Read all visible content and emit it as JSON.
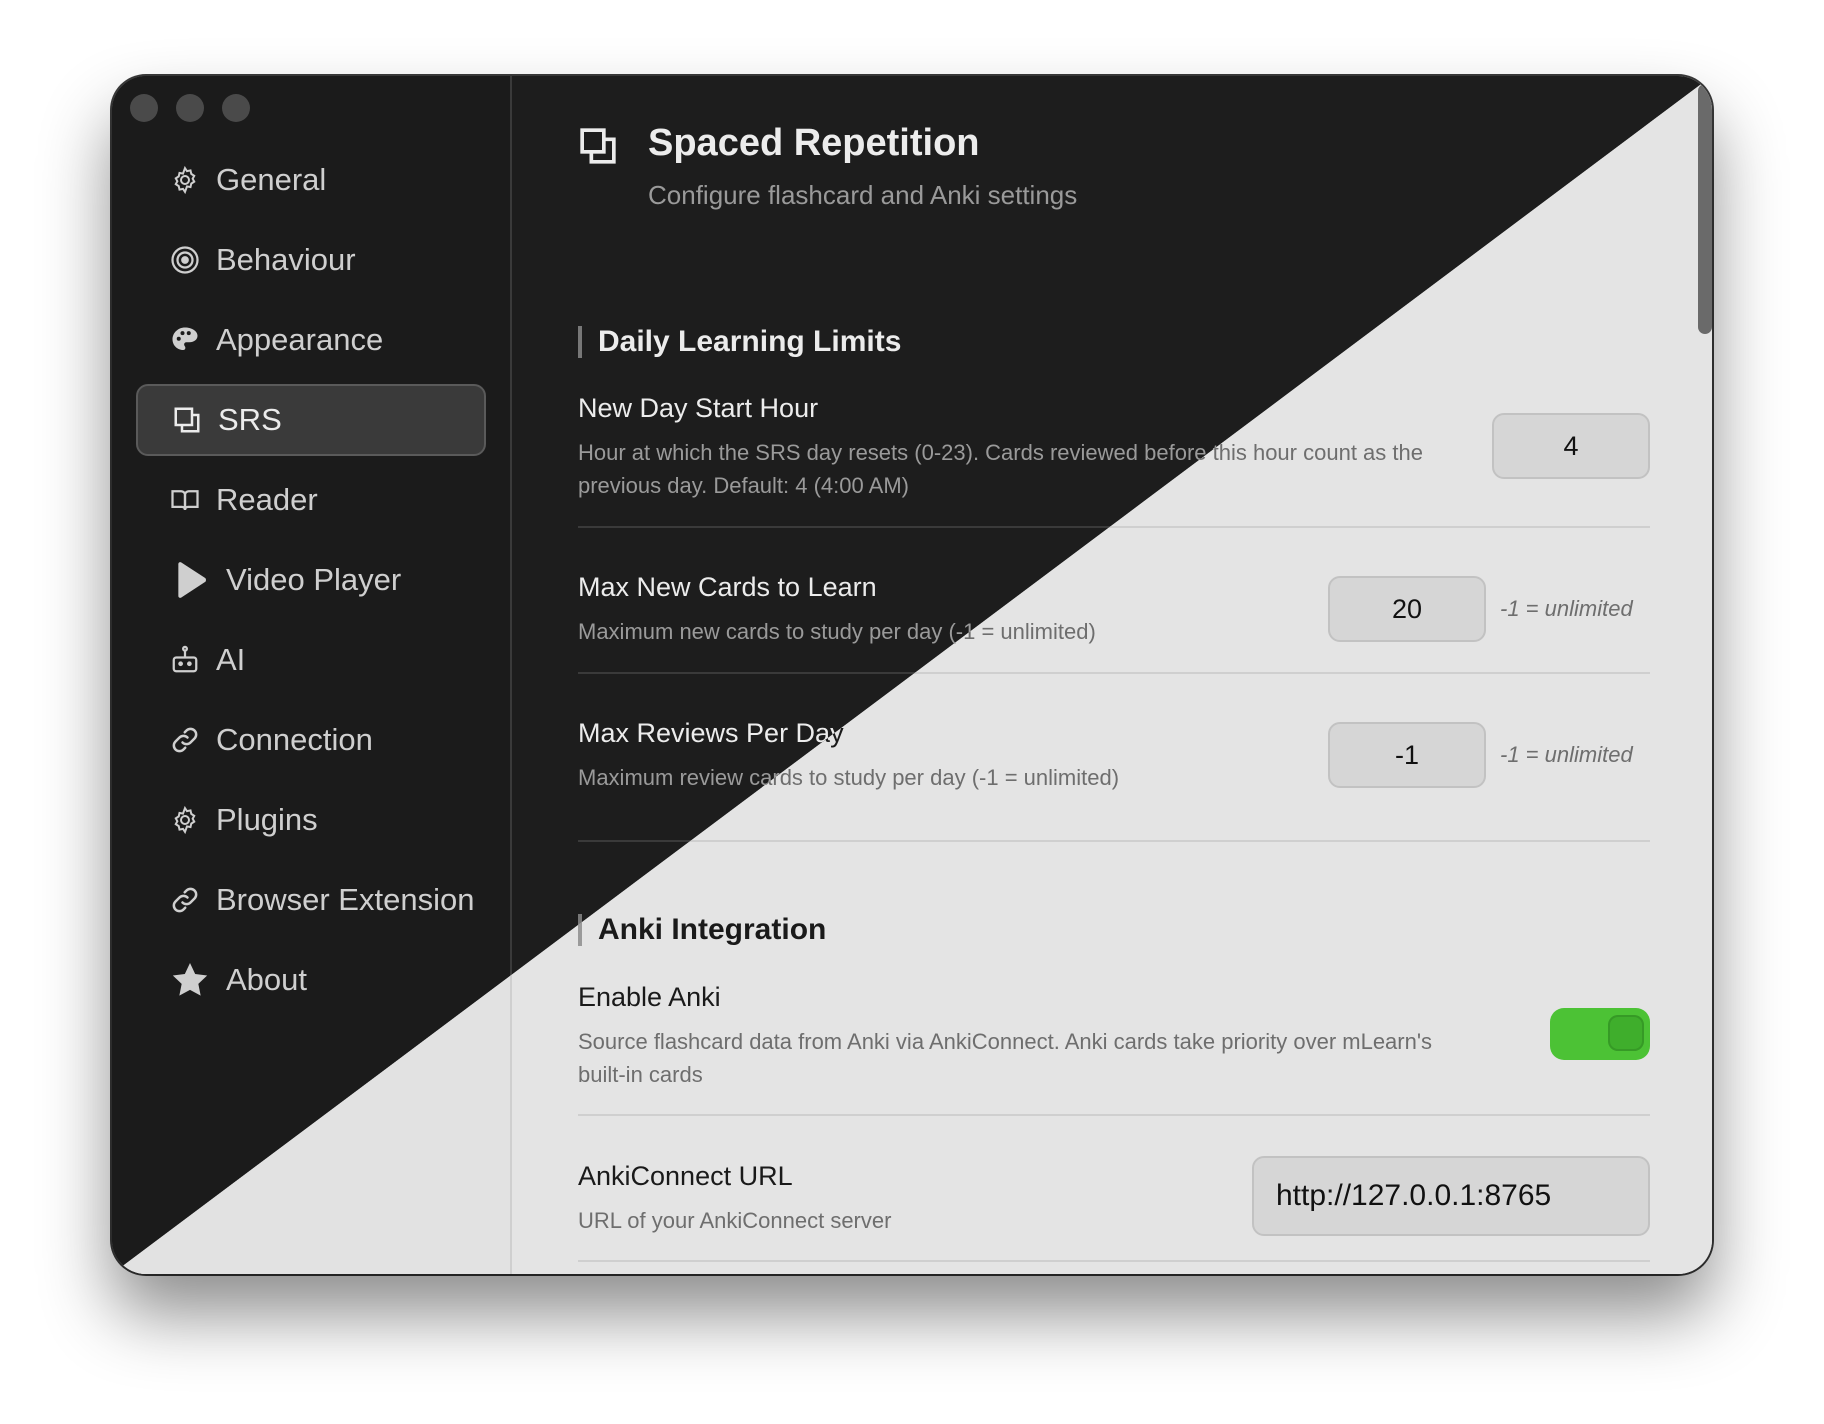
{
  "sidebar": {
    "items": [
      {
        "label": "General",
        "icon": "gear-icon"
      },
      {
        "label": "Behaviour",
        "icon": "target-icon"
      },
      {
        "label": "Appearance",
        "icon": "palette-icon"
      },
      {
        "label": "SRS",
        "icon": "cards-icon",
        "active": true
      },
      {
        "label": "Reader",
        "icon": "book-icon"
      },
      {
        "label": "Video Player",
        "icon": "play-icon"
      },
      {
        "label": "AI",
        "icon": "robot-icon"
      },
      {
        "label": "Connection",
        "icon": "link-icon"
      },
      {
        "label": "Plugins",
        "icon": "gear-icon"
      },
      {
        "label": "Browser Extension",
        "icon": "link-icon"
      },
      {
        "label": "About",
        "icon": "star-icon"
      }
    ]
  },
  "header": {
    "title": "Spaced Repetition",
    "subtitle": "Configure flashcard and Anki settings"
  },
  "sections": {
    "daily": {
      "title": "Daily Learning Limits",
      "new_day": {
        "label": "New Day Start Hour",
        "desc": "Hour at which the SRS day resets (0-23). Cards reviewed before this hour count as the previous day. Default: 4 (4:00 AM)",
        "value": "4"
      },
      "max_new": {
        "label": "Max New Cards to Learn",
        "desc": "Maximum new cards to study per day (-1 = unlimited)",
        "value": "20",
        "hint": "-1 = unlimited"
      },
      "max_reviews": {
        "label": "Max Reviews Per Day",
        "desc": "Maximum review cards to study per day (-1 = unlimited)",
        "value": "-1",
        "hint": "-1 = unlimited"
      }
    },
    "anki": {
      "title": "Anki Integration",
      "enable": {
        "label": "Enable Anki",
        "desc": "Source flashcard data from Anki via AnkiConnect. Anki cards take priority over mLearn's built-in cards",
        "enabled": true
      },
      "url": {
        "label": "AnkiConnect URL",
        "desc": "URL of your AnkiConnect server",
        "value": "http://127.0.0.1:8765"
      }
    }
  },
  "colors": {
    "toggle_on": "#4cc235",
    "dark_bg": "#1d1d1d",
    "light_bg": "#e4e4e4"
  }
}
